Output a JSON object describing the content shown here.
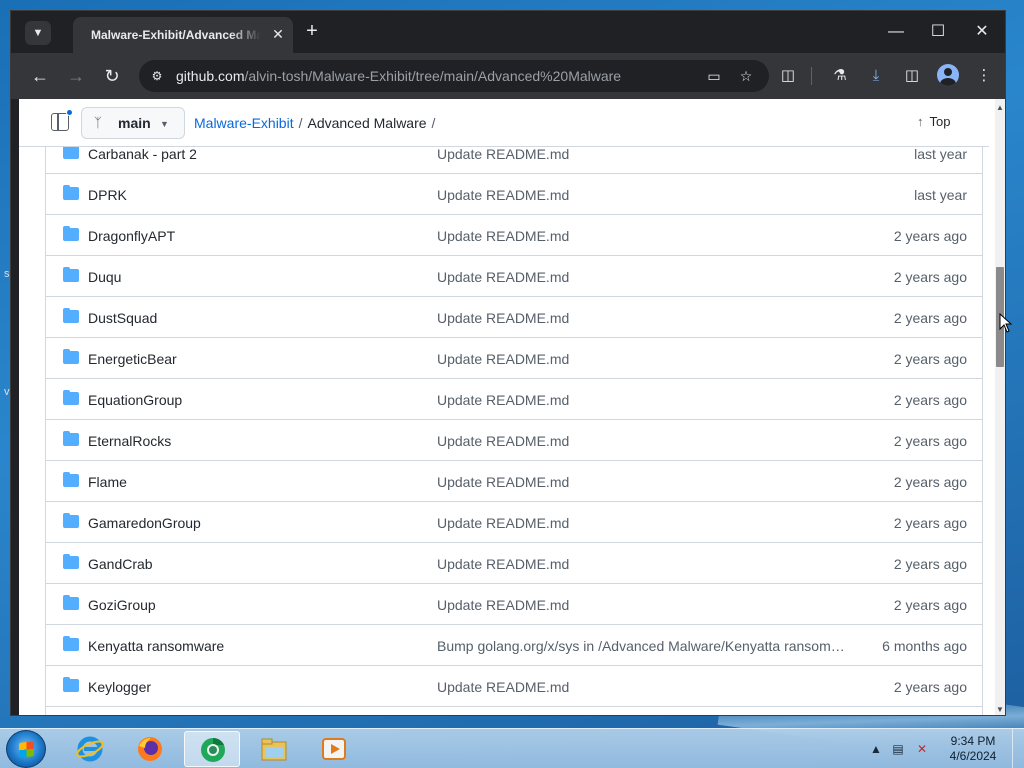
{
  "browser": {
    "tab_title": "Malware-Exhibit/Advanced Ma",
    "url_host": "github.com",
    "url_path": "/alvin-tosh/Malware-Exhibit/tree/main/Advanced%20Malware"
  },
  "repo_header": {
    "branch": "main",
    "breadcrumb_repo": "Malware-Exhibit",
    "breadcrumb_sep": "/",
    "breadcrumb_folder": "Advanced Malware",
    "breadcrumb_trailing": "/",
    "top_label": "Top"
  },
  "files": [
    {
      "name": "Carbanak - part 2",
      "message": "Update README.md",
      "date": "last year"
    },
    {
      "name": "DPRK",
      "message": "Update README.md",
      "date": "last year"
    },
    {
      "name": "DragonflyAPT",
      "message": "Update README.md",
      "date": "2 years ago"
    },
    {
      "name": "Duqu",
      "message": "Update README.md",
      "date": "2 years ago"
    },
    {
      "name": "DustSquad",
      "message": "Update README.md",
      "date": "2 years ago"
    },
    {
      "name": "EnergeticBear",
      "message": "Update README.md",
      "date": "2 years ago"
    },
    {
      "name": "EquationGroup",
      "message": "Update README.md",
      "date": "2 years ago"
    },
    {
      "name": "EternalRocks",
      "message": "Update README.md",
      "date": "2 years ago"
    },
    {
      "name": "Flame",
      "message": "Update README.md",
      "date": "2 years ago"
    },
    {
      "name": "GamaredonGroup",
      "message": "Update README.md",
      "date": "2 years ago"
    },
    {
      "name": "GandCrab",
      "message": "Update README.md",
      "date": "2 years ago"
    },
    {
      "name": "GoziGroup",
      "message": "Update README.md",
      "date": "2 years ago"
    },
    {
      "name": "Kenyatta ransomware",
      "message": "Bump golang.org/x/sys in /Advanced Malware/Kenyatta ransomware",
      "date": "6 months ago"
    },
    {
      "name": "Keylogger",
      "message": "Update README.md",
      "date": "2 years ago"
    },
    {
      "name": "",
      "message": "",
      "date": ""
    }
  ],
  "taskbar": {
    "time": "9:34 PM",
    "date": "4/6/2024"
  },
  "colors": {
    "link": "#0969da",
    "folder": "#54aeff",
    "browser_dark": "#202124",
    "toolbar": "#35363a"
  },
  "icons": [
    "tab-search-icon",
    "github-favicon",
    "close-icon",
    "plus-icon",
    "minimize-icon",
    "maximize-icon",
    "back-arrow-icon",
    "forward-arrow-icon",
    "reload-icon",
    "site-info-icon",
    "install-app-icon",
    "bookmark-star-icon",
    "extensions-icon",
    "labs-flask-icon",
    "download-icon",
    "side-panel-icon",
    "profile-avatar-icon",
    "kebab-menu-icon",
    "sidebar-toggle-icon",
    "branch-icon",
    "arrow-up-icon",
    "folder-icon",
    "windows-start-icon",
    "internet-explorer-icon",
    "firefox-icon",
    "chrome-icon",
    "file-explorer-icon",
    "media-player-icon",
    "network-icon",
    "volume-muted-icon"
  ]
}
